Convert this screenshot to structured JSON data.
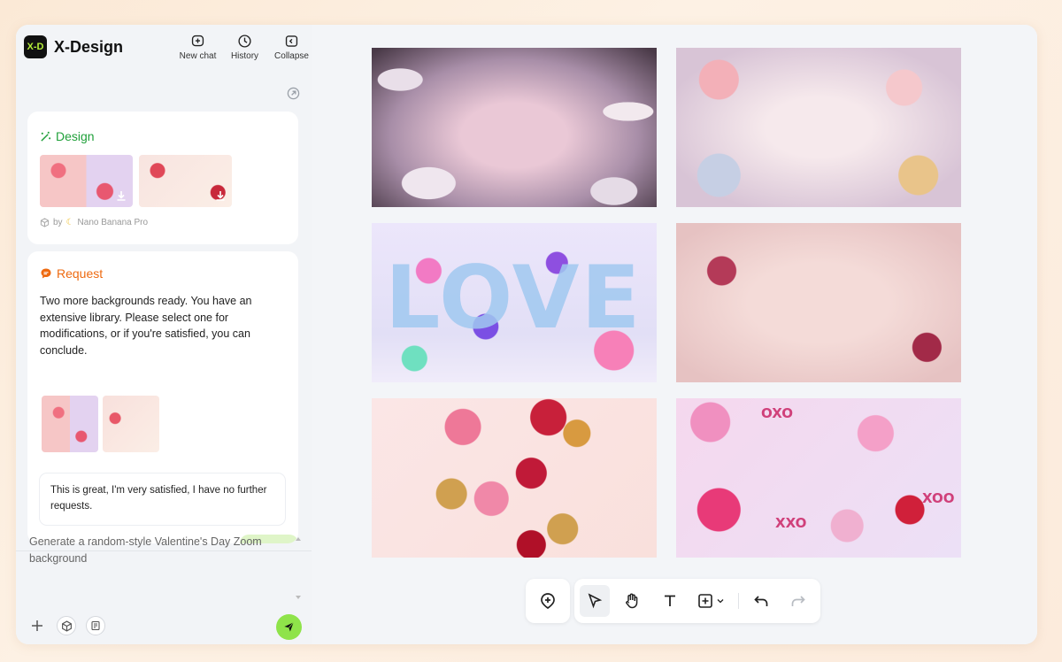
{
  "app": {
    "name": "X-Design",
    "logo_text": "X-D",
    "accent_green": "#8fe34a",
    "design_green": "#20a03a",
    "request_orange": "#ee6a10"
  },
  "header": {
    "actions": [
      {
        "label": "New chat",
        "icon": "new-chat-icon"
      },
      {
        "label": "History",
        "icon": "clock-icon"
      },
      {
        "label": "Collapse",
        "icon": "collapse-icon"
      }
    ]
  },
  "design_card": {
    "title": "Design",
    "by_prefix": "by",
    "model": "Nano Banana Pro"
  },
  "request_card": {
    "title": "Request",
    "message": "Two more backgrounds ready. You have an extensive library. Please select one for modifications, or if you're satisfied, you can conclude.",
    "user_reply": "This is great, I'm very satisfied, I have no further requests."
  },
  "composer": {
    "prompt": "Generate a random-style Valentine's Day Zoom background"
  },
  "canvas": {
    "love_text": "LOVE",
    "xo_labels": [
      "OXO",
      "XOO",
      "XXO"
    ]
  },
  "toolbar": {
    "tools": [
      "add-element-icon",
      "select-arrow-icon",
      "hand-icon",
      "text-icon",
      "insert-icon",
      "undo-icon",
      "redo-icon"
    ]
  }
}
